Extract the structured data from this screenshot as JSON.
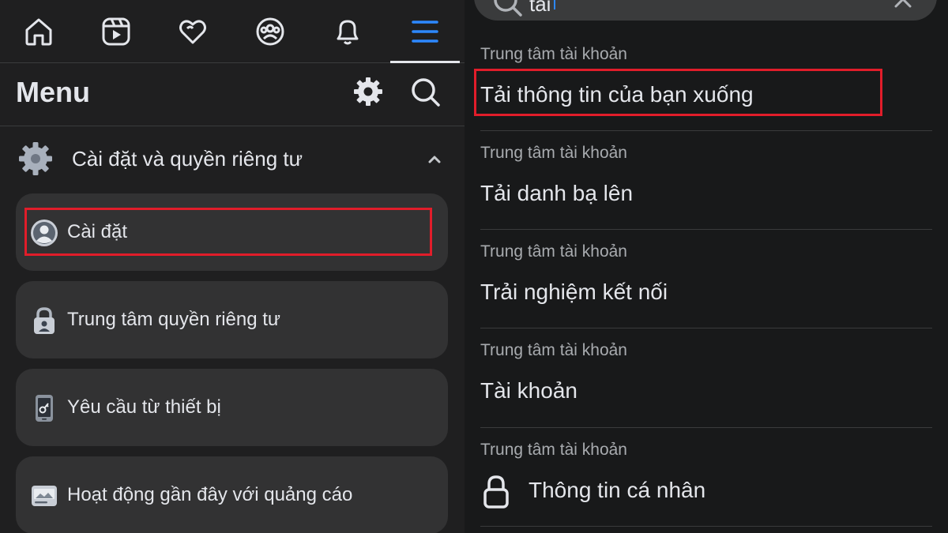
{
  "nav": {
    "items": [
      {
        "name": "home-icon"
      },
      {
        "name": "video-icon"
      },
      {
        "name": "dating-heart-icon"
      },
      {
        "name": "groups-icon"
      },
      {
        "name": "notifications-bell-icon"
      },
      {
        "name": "menu-hamburger-icon",
        "active": true
      }
    ]
  },
  "menu": {
    "title": "Menu",
    "settings_icon": "gear-icon",
    "search_icon": "search-icon"
  },
  "section": {
    "label": "Cài đặt và quyền riêng tư",
    "icon": "gear-icon",
    "expanded": true
  },
  "cards": [
    {
      "label": "Cài đặt",
      "icon": "profile-circle-icon",
      "highlighted": true
    },
    {
      "label": "Trung tâm quyền riêng tư",
      "icon": "privacy-lock-icon"
    },
    {
      "label": "Yêu cầu từ thiết bị",
      "icon": "device-phone-icon"
    },
    {
      "label": "Hoạt động gần đây với quảng cáo",
      "icon": "ad-activity-icon"
    }
  ],
  "search": {
    "query": "tải"
  },
  "results": [
    {
      "subtitle": "Trung tâm tài khoản",
      "title": "Tải thông tin của bạn xuống",
      "highlighted": true
    },
    {
      "subtitle": "Trung tâm tài khoản",
      "title": "Tải danh bạ lên"
    },
    {
      "subtitle": "Trung tâm tài khoản",
      "title": "Trải nghiệm kết nối"
    },
    {
      "subtitle": "Trung tâm tài khoản",
      "title": "Tài khoản"
    },
    {
      "subtitle": "Trung tâm tài khoản",
      "title": "Thông tin cá nhân",
      "icon": "lock-icon"
    }
  ],
  "colors": {
    "accent": "#2d88ff",
    "highlight_box": "#e11d2a",
    "panel_left": "#1f1f20",
    "panel_right": "#18191a",
    "card": "#323233"
  }
}
